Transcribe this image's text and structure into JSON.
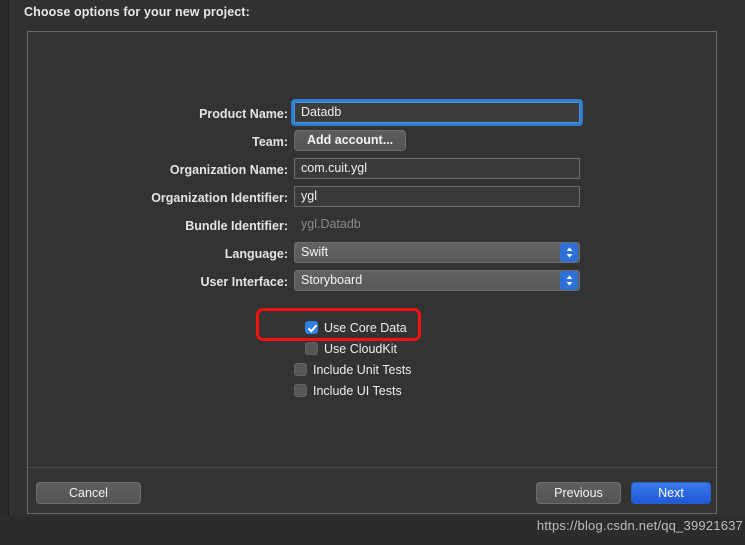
{
  "dialog": {
    "title": "Choose options for your new project:"
  },
  "form": {
    "fields": [
      {
        "label": "Product Name:",
        "value": "Datadb",
        "type": "text",
        "state": "focused"
      },
      {
        "label": "Team:",
        "value": "Add account...",
        "type": "button",
        "state": "normal"
      },
      {
        "label": "Organization Name:",
        "value": "com.cuit.ygl",
        "type": "text",
        "state": "normal"
      },
      {
        "label": "Organization Identifier:",
        "value": "ygl",
        "type": "text",
        "state": "normal"
      },
      {
        "label": "Bundle Identifier:",
        "value": "ygl.Datadb",
        "type": "text",
        "state": "readonly"
      },
      {
        "label": "Language:",
        "value": "Swift",
        "type": "select",
        "state": "normal"
      },
      {
        "label": "User Interface:",
        "value": "Storyboard",
        "type": "select",
        "state": "normal"
      }
    ]
  },
  "options": {
    "checkboxes": [
      {
        "label": "Use Core Data",
        "checked": true,
        "indent": 1,
        "highlighted": true
      },
      {
        "label": "Use CloudKit",
        "checked": false,
        "indent": 1,
        "highlighted": false
      },
      {
        "label": "Include Unit Tests",
        "checked": false,
        "indent": 0,
        "highlighted": false
      },
      {
        "label": "Include UI Tests",
        "checked": false,
        "indent": 0,
        "highlighted": false
      }
    ]
  },
  "footer": {
    "cancel_label": "Cancel",
    "previous_label": "Previous",
    "next_label": "Next"
  },
  "watermark": {
    "text": "https://blog.csdn.net/qq_39921637"
  },
  "colors": {
    "accent_blue": "#2f7fdf",
    "default_button_blue": "#2058d8",
    "annotation_red": "#f41010",
    "panel_bg": "#333333",
    "window_bg": "#313131"
  }
}
